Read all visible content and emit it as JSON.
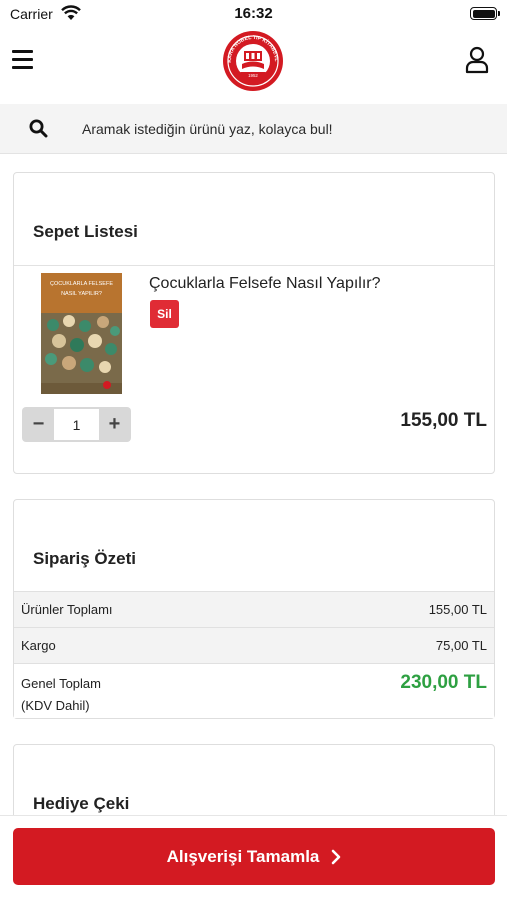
{
  "status_bar": {
    "carrier": "Carrier",
    "time": "16:32"
  },
  "header": {
    "logo_text": "ANKARA NOBEL TIP KİTABEVLERİ",
    "logo_year": "1952",
    "icons": {
      "menu": "hamburger-icon",
      "profile": "user-icon"
    }
  },
  "search": {
    "placeholder": "Aramak istediğin ürünü yaz, kolayca bul!",
    "icon": "search-icon"
  },
  "cart": {
    "title": "Sepet Listesi",
    "items": [
      {
        "title": "Çocuklarla Felsefe Nasıl Yapılır?",
        "remove_label": "Sil",
        "quantity": "1",
        "price": "155,00 TL",
        "cover_title_line1": "ÇOCUKLARLA FELSEFE",
        "cover_title_line2": "NASIL YAPILIR?"
      }
    ],
    "minus_label": "−",
    "plus_label": "+"
  },
  "summary": {
    "title": "Sipariş Özeti",
    "rows": [
      {
        "label": "Ürünler Toplamı",
        "value": "155,00 TL"
      },
      {
        "label": "Kargo",
        "value": "75,00 TL"
      }
    ],
    "total": {
      "label_line1": "Genel Toplam",
      "label_line2": "(KDV Dahil)",
      "value": "230,00 TL"
    }
  },
  "gift": {
    "title": "Hediye Çeki"
  },
  "checkout": {
    "label": "Alışverişi Tamamla",
    "icon": "chevron-right-icon"
  },
  "colors": {
    "accent_red": "#d31a22",
    "remove_red": "#e02c35",
    "total_green": "#2ea042"
  }
}
